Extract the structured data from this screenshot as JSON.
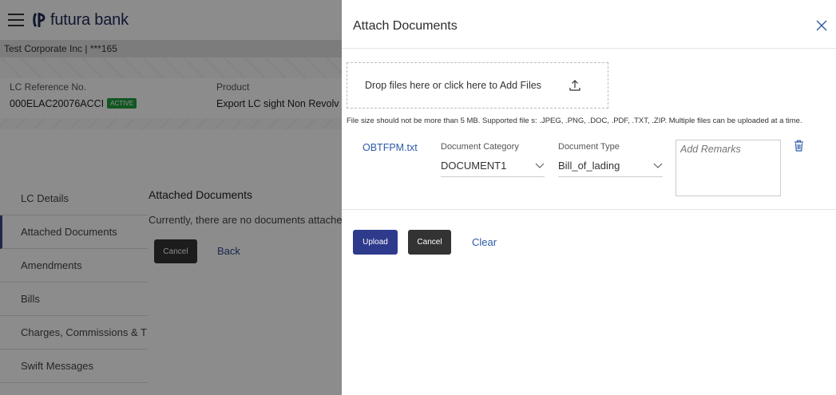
{
  "app": {
    "brand": "futura bank"
  },
  "account_bar": {
    "text": "Test Corporate Inc | ***165"
  },
  "lc_header": {
    "ref_label": "LC Reference No.",
    "ref_value": "000ELAC20076ACCI",
    "status_badge": "ACTIVE",
    "product_label": "Product",
    "product_value": "Export LC sight Non Revolv"
  },
  "sidebar": {
    "items": [
      {
        "label": "LC Details",
        "active": false
      },
      {
        "label": "Attached Documents",
        "active": true
      },
      {
        "label": "Amendments",
        "active": false
      },
      {
        "label": "Bills",
        "active": false
      },
      {
        "label": "Charges, Commissions & T",
        "active": false
      },
      {
        "label": "Swift Messages",
        "active": false
      }
    ]
  },
  "main": {
    "title": "Attached Documents",
    "message": "Currently, there are no documents attached",
    "cancel_label": "Cancel",
    "back_label": "Back"
  },
  "panel": {
    "title": "Attach Documents",
    "dropzone_text": "Drop files here or click here to Add Files",
    "size_note": "File size should not be more than 5 MB. Supported file s: .JPEG, .PNG, .DOC, .PDF, .TXT, .ZIP. Multiple files can be uploaded at a time.",
    "file": {
      "name": "OBTFPM.txt",
      "category_label": "Document Category",
      "category_value": "DOCUMENT1",
      "type_label": "Document Type",
      "type_value": "Bill_of_lading",
      "remarks_placeholder": "Add Remarks"
    },
    "upload_label": "Upload",
    "cancel_label": "Cancel",
    "clear_label": "Clear"
  },
  "colors": {
    "brand_navy": "#1d2a55",
    "primary_button": "#2e3a8c",
    "dark_button": "#333333",
    "link": "#2d5aa8",
    "active_badge": "#1f9f3f"
  },
  "icons": [
    "hamburger-icon",
    "futura-logo-icon",
    "close-icon",
    "upload-icon",
    "chevron-down-icon",
    "trash-icon"
  ]
}
